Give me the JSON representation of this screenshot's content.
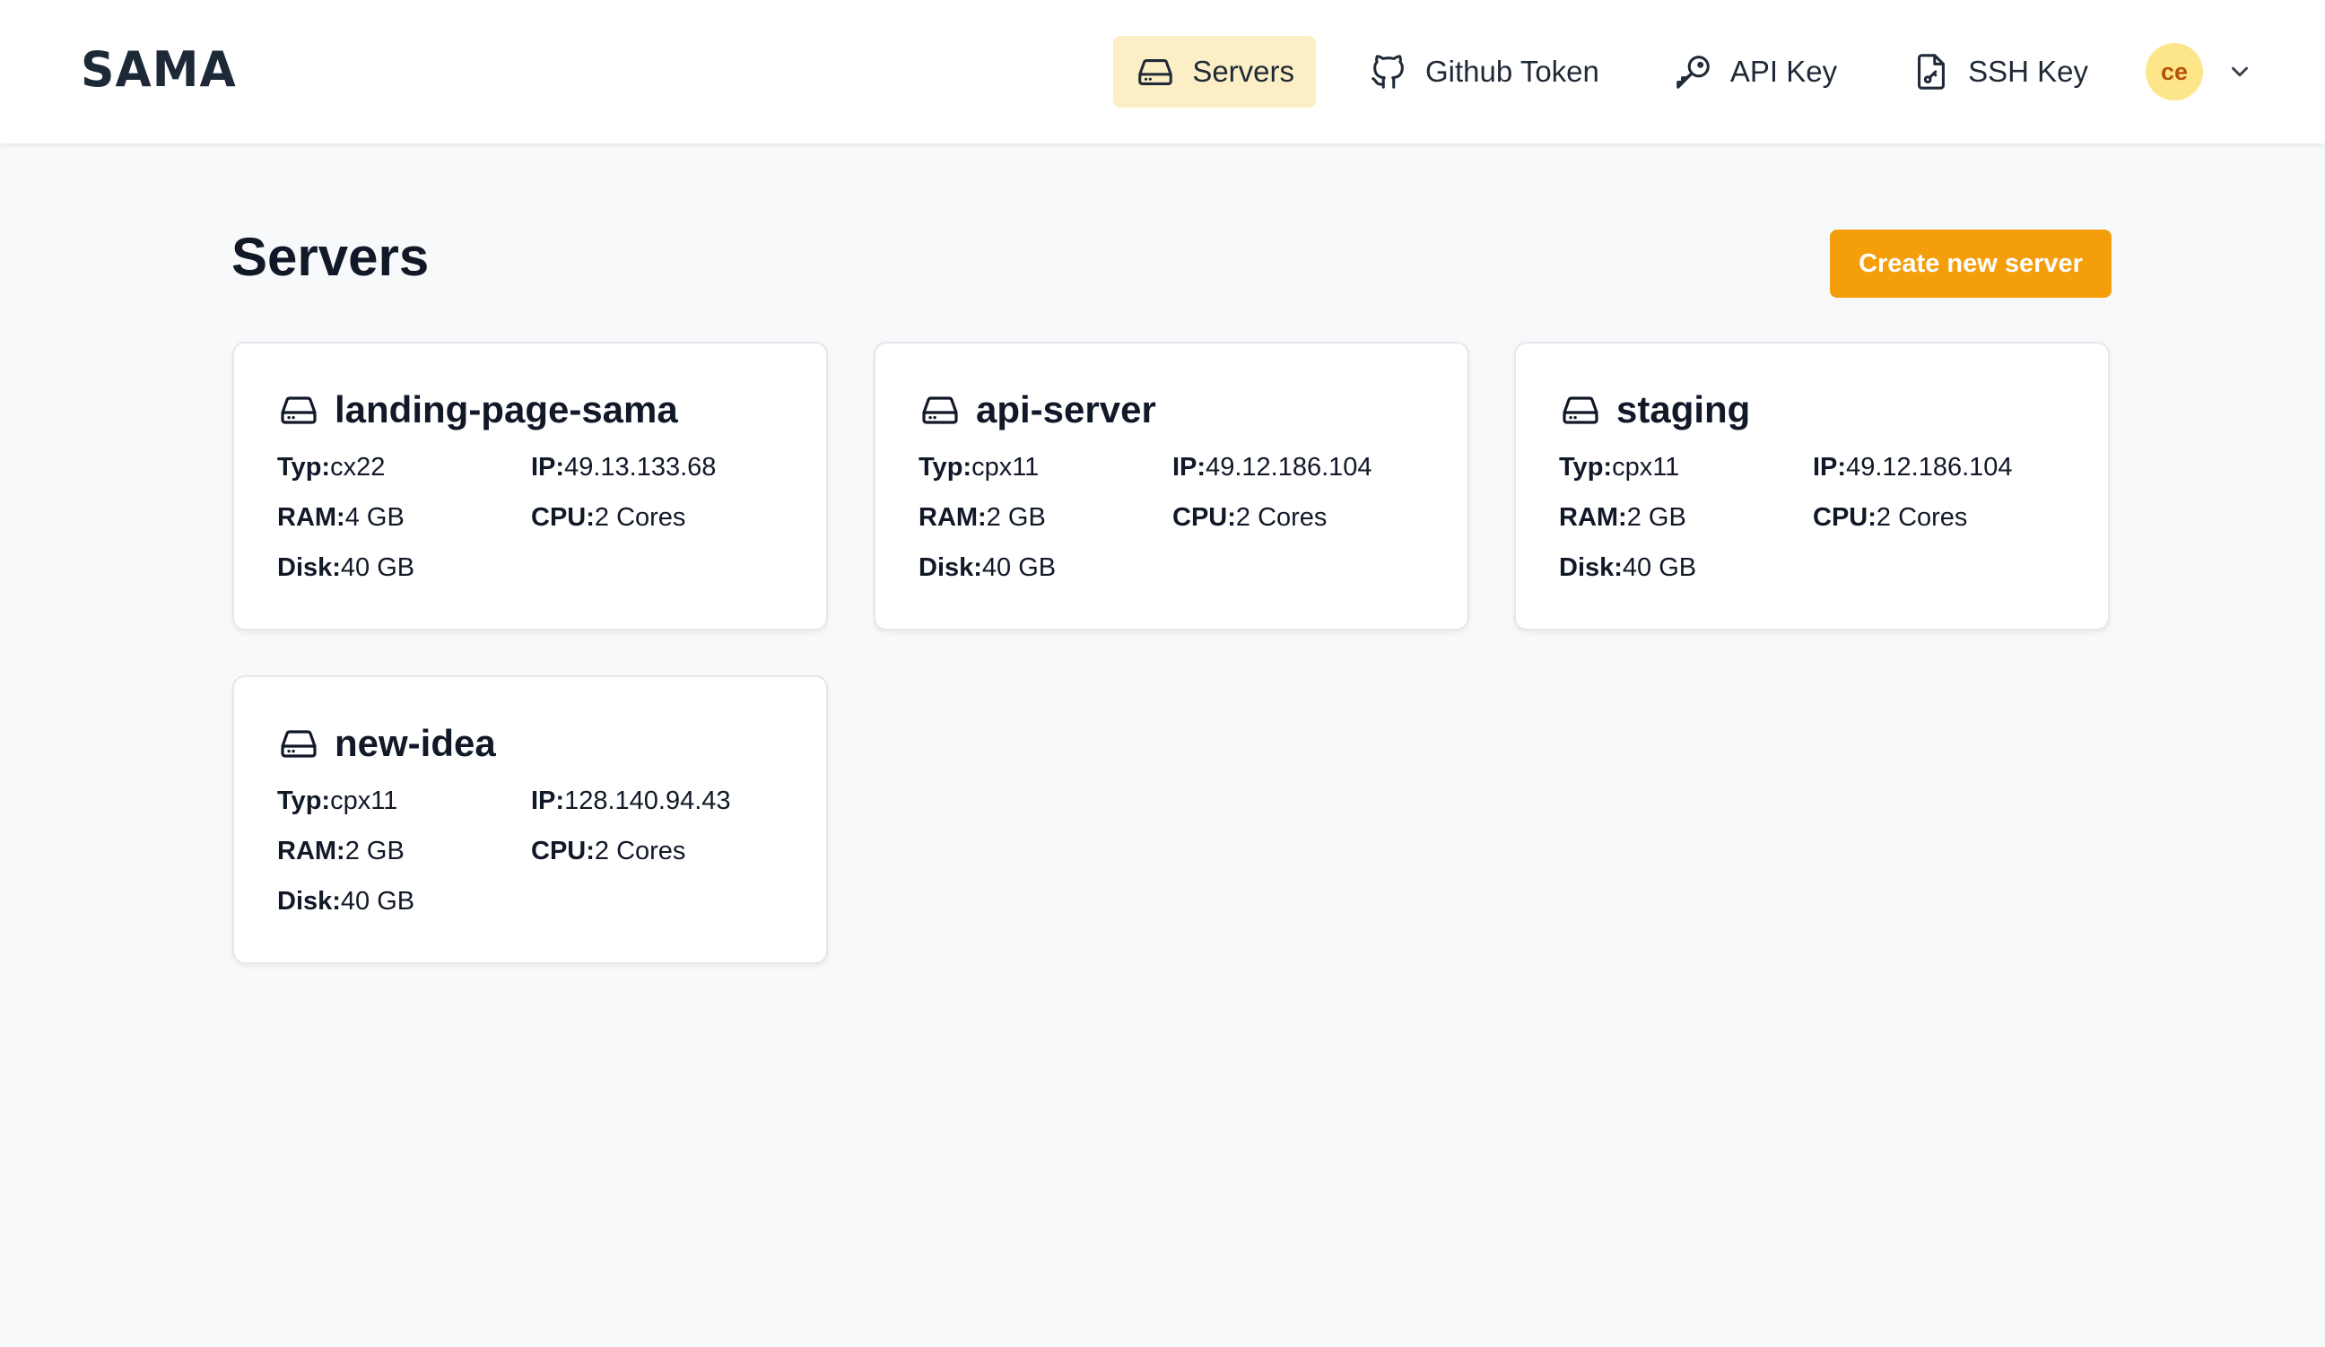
{
  "app": {
    "logo": "SAMA"
  },
  "nav": {
    "items": [
      {
        "label": "Servers",
        "icon": "server-icon",
        "active": true
      },
      {
        "label": "Github Token",
        "icon": "github-icon",
        "active": false
      },
      {
        "label": "API Key",
        "icon": "key-icon",
        "active": false
      },
      {
        "label": "SSH Key",
        "icon": "document-key-icon",
        "active": false
      }
    ],
    "user_initials": "ce"
  },
  "main": {
    "title": "Servers",
    "create_button": "Create new server",
    "labels": {
      "type": "Typ:",
      "ip": "IP:",
      "ram": "RAM:",
      "cpu": "CPU:",
      "disk": "Disk:"
    },
    "servers": [
      {
        "name": "landing-page-sama",
        "type": "cx22",
        "ip": "49.13.133.68",
        "ram": "4 GB",
        "cpu": "2 Cores",
        "disk": "40 GB"
      },
      {
        "name": "api-server",
        "type": "cpx11",
        "ip": "49.12.186.104",
        "ram": "2 GB",
        "cpu": "2 Cores",
        "disk": "40 GB"
      },
      {
        "name": "staging",
        "type": "cpx11",
        "ip": "49.12.186.104",
        "ram": "2 GB",
        "cpu": "2 Cores",
        "disk": "40 GB"
      },
      {
        "name": "new-idea",
        "type": "cpx11",
        "ip": "128.140.94.43",
        "ram": "2 GB",
        "cpu": "2 Cores",
        "disk": "40 GB"
      }
    ]
  },
  "colors": {
    "accent": "#f59e0b",
    "active_nav_bg": "#fdefc5",
    "avatar_bg": "#fde68a",
    "avatar_text": "#b45309"
  }
}
